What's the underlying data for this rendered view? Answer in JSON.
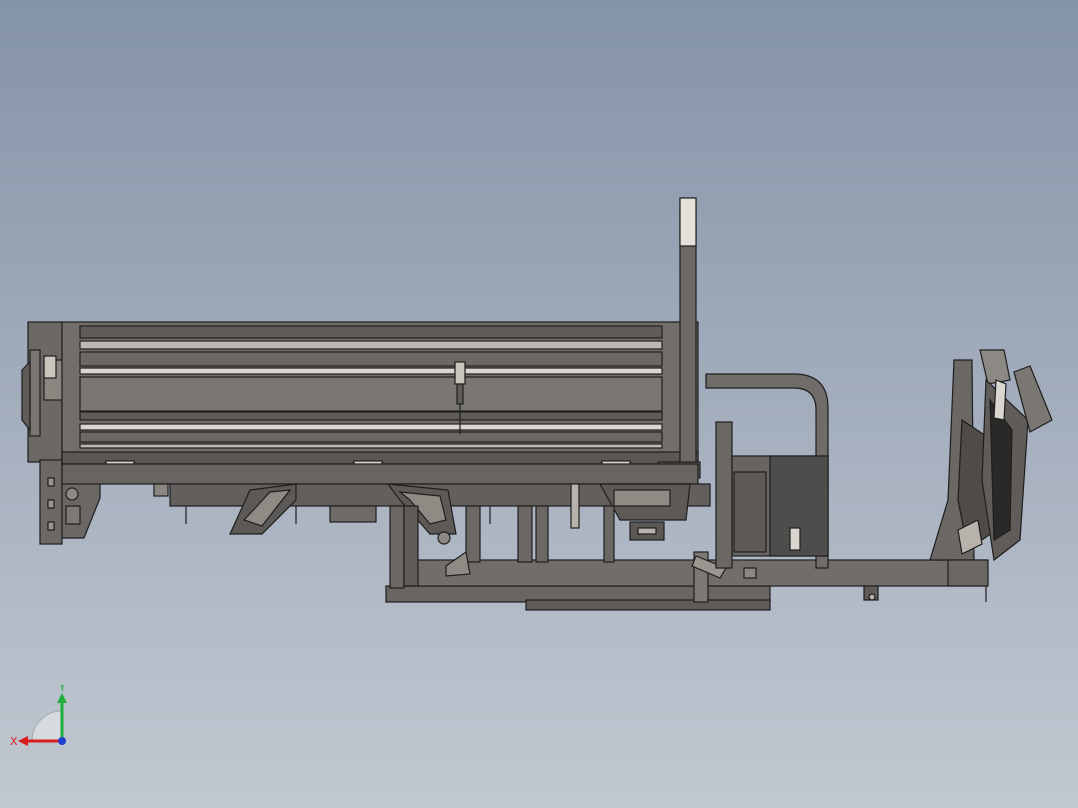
{
  "scene": {
    "background_top": "#8593a8",
    "background_bottom": "#c1c8d1",
    "metal_color": "#6f6c69",
    "edge_color": "#1e1e1e",
    "highlight_color": "#d9d5cf"
  },
  "triad": {
    "x_label": "X",
    "y_label": "Y",
    "x_color": "#d81e1e",
    "y_color": "#1fae3a",
    "z_color": "#1f3fd0"
  }
}
